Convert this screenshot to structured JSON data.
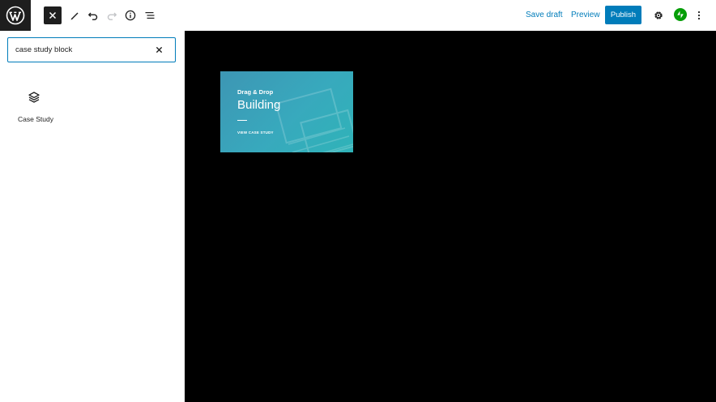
{
  "toolbar": {
    "save_draft": "Save draft",
    "preview": "Preview",
    "publish": "Publish"
  },
  "inserter": {
    "search_value": "case study block",
    "search_placeholder": "Search",
    "results": [
      {
        "label": "Case Study",
        "icon": "layers-icon"
      }
    ]
  },
  "canvas": {
    "card": {
      "kicker": "Drag & Drop",
      "title": "Building",
      "link": "VIEW CASE STUDY"
    }
  },
  "colors": {
    "accent": "#007cba",
    "dark": "#1e1e1e",
    "canvas_bg": "#000000",
    "card_teal": "#38a9bd",
    "jetpack_green": "#069e08"
  },
  "icons": [
    "wordpress-logo-icon",
    "close-icon",
    "pencil-icon",
    "undo-icon",
    "redo-icon",
    "info-icon",
    "list-view-icon",
    "gear-icon",
    "jetpack-icon",
    "more-vertical-icon",
    "layers-icon"
  ]
}
